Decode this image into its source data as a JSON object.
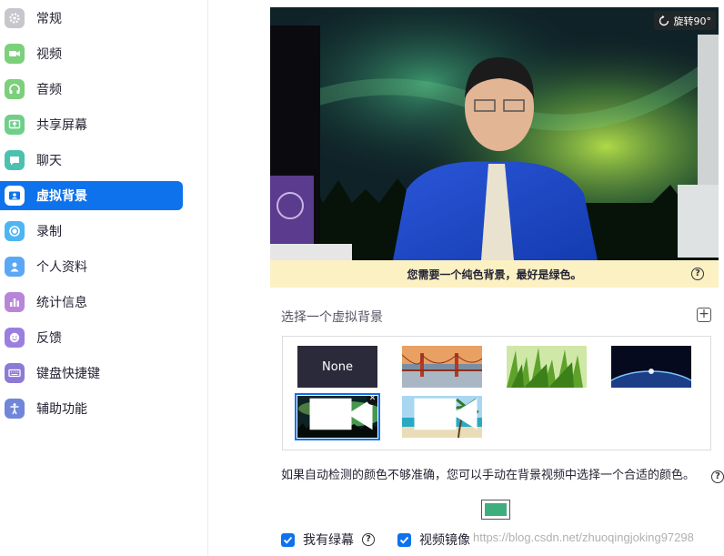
{
  "sidebar": {
    "items": [
      {
        "label": "常规",
        "icon": "gear-icon",
        "color": "#c6c6cc"
      },
      {
        "label": "视频",
        "icon": "video-camera-icon",
        "color": "#7ccf7b"
      },
      {
        "label": "音频",
        "icon": "headphones-icon",
        "color": "#7ccf7b"
      },
      {
        "label": "共享屏幕",
        "icon": "share-screen-icon",
        "color": "#6fcf8a"
      },
      {
        "label": "聊天",
        "icon": "chat-bubble-icon",
        "color": "#4bc1b0"
      },
      {
        "label": "虚拟背景",
        "icon": "person-card-icon",
        "color": "#0e72ed"
      },
      {
        "label": "录制",
        "icon": "record-icon",
        "color": "#4fb5f2"
      },
      {
        "label": "个人资料",
        "icon": "profile-icon",
        "color": "#5aa7f5"
      },
      {
        "label": "统计信息",
        "icon": "bar-chart-icon",
        "color": "#b786d9"
      },
      {
        "label": "反馈",
        "icon": "smiley-icon",
        "color": "#9b7fe0"
      },
      {
        "label": "键盘快捷键",
        "icon": "keyboard-icon",
        "color": "#8d7ad6"
      },
      {
        "label": "辅助功能",
        "icon": "accessibility-icon",
        "color": "#6f86d9"
      }
    ],
    "active_index": 5
  },
  "preview": {
    "rotate_label": "旋转90°",
    "notice": "您需要一个纯色背景，最好是绿色。"
  },
  "backgrounds": {
    "title": "选择一个虚拟背景",
    "none_label": "None",
    "items": [
      "None",
      "golden-gate-bridge",
      "grass",
      "earth-from-space",
      "aurora",
      "beach-palm"
    ],
    "selected": "aurora"
  },
  "hint": "如果自动检测的颜色不够准确，您可以手动在背景视频中选择一个合适的颜色。",
  "key_color": "#3fae7f",
  "options": {
    "green_screen_label": "我有绿幕",
    "mirror_label": "视频镜像"
  },
  "watermark": "https://blog.csdn.net/zhuoqingjoking97298"
}
